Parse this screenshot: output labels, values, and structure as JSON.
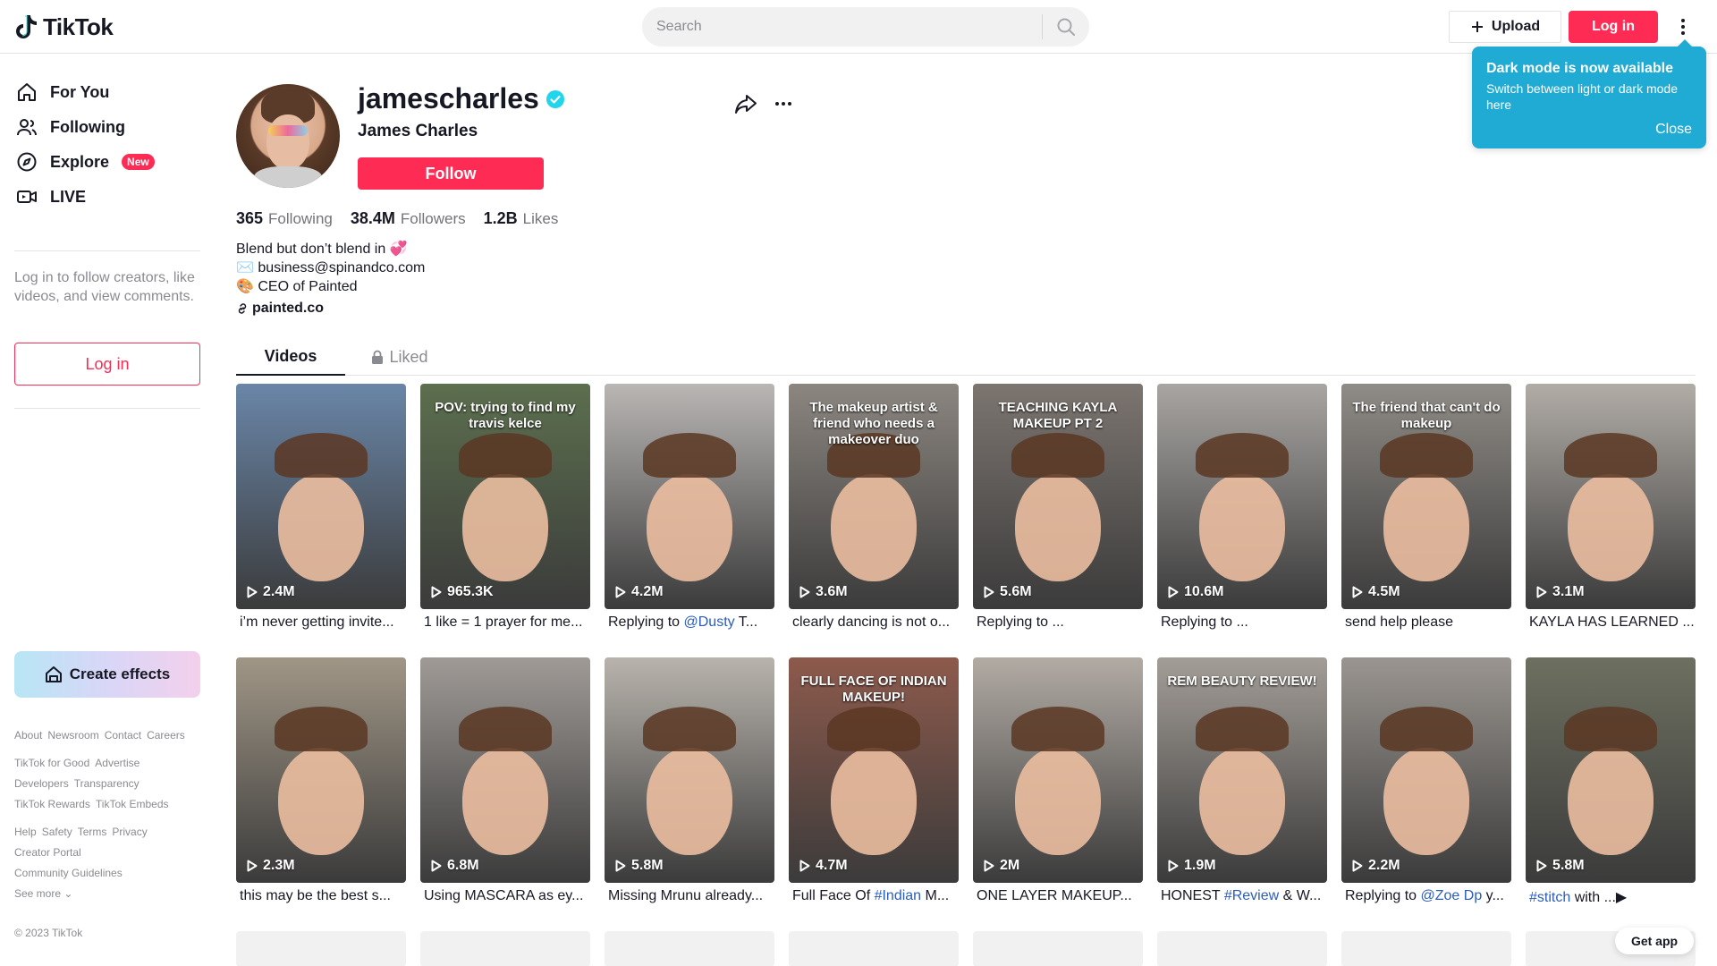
{
  "header": {
    "logo_text": "TikTok",
    "search_placeholder": "Search",
    "upload_label": "Upload",
    "login_label": "Log in"
  },
  "tooltip": {
    "title": "Dark mode is now available",
    "body": "Switch between light or dark mode here",
    "close": "Close",
    "color": "#1fabd4"
  },
  "sidebar": {
    "items": [
      {
        "label": "For You",
        "icon": "home-icon"
      },
      {
        "label": "Following",
        "icon": "people-icon"
      },
      {
        "label": "Explore",
        "icon": "compass-icon",
        "badge": "New"
      },
      {
        "label": "LIVE",
        "icon": "live-icon"
      }
    ],
    "login_note": "Log in to follow creators, like videos, and view comments.",
    "login_label": "Log in",
    "effects_label": "Create effects",
    "footer": [
      [
        "About",
        "Newsroom",
        "Contact",
        "Careers"
      ],
      [
        "TikTok for Good",
        "Advertise"
      ],
      [
        "Developers",
        "Transparency"
      ],
      [
        "TikTok Rewards",
        "TikTok Embeds"
      ],
      [
        "Help",
        "Safety",
        "Terms",
        "Privacy"
      ],
      [
        "Creator Portal"
      ],
      [
        "Community Guidelines"
      ]
    ],
    "see_more": "See more",
    "copyright": "© 2023 TikTok"
  },
  "profile": {
    "username": "jamescharles",
    "display_name": "James Charles",
    "follow_label": "Follow",
    "stats": [
      {
        "value": "365",
        "label": "Following"
      },
      {
        "value": "38.4M",
        "label": "Followers"
      },
      {
        "value": "1.2B",
        "label": "Likes"
      }
    ],
    "bio": [
      "Blend but don’t blend in 💞",
      "✉️ business@spinandco.com",
      "🎨 CEO of Painted"
    ],
    "link": "painted.co"
  },
  "tabs": {
    "videos": "Videos",
    "liked": "Liked"
  },
  "videos": [
    {
      "views": "2.4M",
      "caption": "i’m never getting invite...",
      "overlay": "",
      "bg": "#6a86a8"
    },
    {
      "views": "965.3K",
      "caption": "1 like = 1 prayer for me...",
      "overlay": "POV: trying to find my travis kelce",
      "bg": "#5c6f4e"
    },
    {
      "views": "4.2M",
      "caption_pre": "Replying to ",
      "caption_tag": "@Dusty",
      "caption_post": " T...",
      "overlay": "",
      "bg": "#b9b6b4"
    },
    {
      "views": "3.6M",
      "caption": "clearly dancing is not o...",
      "overlay": "The makeup artist & friend who needs a makeover duo",
      "bg": "#8c8680"
    },
    {
      "views": "5.6M",
      "caption": "Replying to ...",
      "overlay": "TEACHING KAYLA MAKEUP PT 2",
      "bg": "#7c7570"
    },
    {
      "views": "10.6M",
      "caption": "Replying to ...",
      "overlay": "",
      "bg": "#a8a5a2"
    },
    {
      "views": "4.5M",
      "caption": "send help please",
      "overlay": "The friend that can't do makeup",
      "bg": "#8f8b86"
    },
    {
      "views": "3.1M",
      "caption": "KAYLA HAS LEARNED ...",
      "overlay": "",
      "bg": "#b1aca6"
    },
    {
      "views": "2.3M",
      "caption": "this may be the best s...",
      "overlay": "",
      "bg": "#a09686"
    },
    {
      "views": "6.8M",
      "caption": "Using MASCARA as ey...",
      "overlay": "",
      "bg": "#9f9a96"
    },
    {
      "views": "5.8M",
      "caption": "Missing Mrunu already...",
      "overlay": "",
      "bg": "#b8b3ac"
    },
    {
      "views": "4.7M",
      "caption_pre": "Full Face Of ",
      "caption_tag": "#Indian",
      "caption_post": " M...",
      "overlay": "FULL FACE OF INDIAN MAKEUP!",
      "bg": "#8d5a4c"
    },
    {
      "views": "2M",
      "caption": "ONE LAYER MAKEUP... ",
      "overlay": "",
      "bg": "#b2aba4"
    },
    {
      "views": "1.9M",
      "caption_pre": "HONEST ",
      "caption_tag": "#Review",
      "caption_post": " & W...",
      "overlay": "REM BEAUTY REVIEW!",
      "bg": "#a39d97"
    },
    {
      "views": "2.2M",
      "caption_pre": "Replying to ",
      "caption_tag": "@Zoe Dp",
      "caption_post": " y...",
      "overlay": "",
      "bg": "#9a9590"
    },
    {
      "views": "5.8M",
      "caption_tag": "#stitch",
      "caption_post": " with ...▶",
      "overlay": "",
      "bg": "#6d7060"
    }
  ],
  "get_app": "Get app"
}
